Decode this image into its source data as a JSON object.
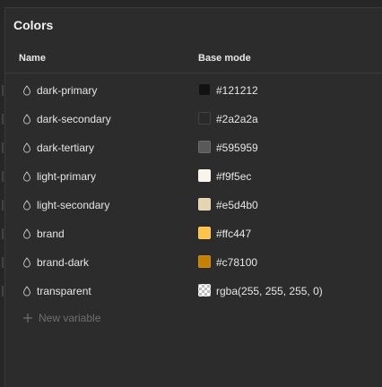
{
  "panel": {
    "title": "Colors"
  },
  "columns": {
    "name": "Name",
    "mode": "Base mode"
  },
  "variables": [
    {
      "name": "dark-primary",
      "value": "#121212",
      "color": "#121212",
      "icon": "drop-icon"
    },
    {
      "name": "dark-secondary",
      "value": "#2a2a2a",
      "color": "#2a2a2a",
      "icon": "drop-icon"
    },
    {
      "name": "dark-tertiary",
      "value": "#595959",
      "color": "#595959",
      "icon": "drop-icon"
    },
    {
      "name": "light-primary",
      "value": "#f9f5ec",
      "color": "#f9f5ec",
      "icon": "drop-icon"
    },
    {
      "name": "light-secondary",
      "value": "#e5d4b0",
      "color": "#e5d4b0",
      "icon": "drop-icon"
    },
    {
      "name": "brand",
      "value": "#ffc447",
      "color": "#ffc447",
      "icon": "drop-icon"
    },
    {
      "name": "brand-dark",
      "value": "#c78100",
      "color": "#c78100",
      "icon": "drop-icon"
    },
    {
      "name": "transparent",
      "value": "rgba(255, 255, 255, 0)",
      "color": "transparent",
      "icon": "drop-icon"
    }
  ],
  "new_variable": {
    "label": "New variable",
    "icon": "plus-icon"
  }
}
